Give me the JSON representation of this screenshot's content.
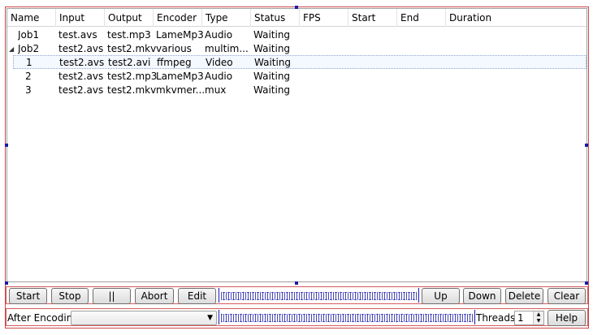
{
  "columns": [
    "Name",
    "Input",
    "Output",
    "Encoder",
    "Type",
    "Status",
    "FPS",
    "Start",
    "End",
    "Duration"
  ],
  "rows": [
    {
      "name": "Job1",
      "input": "test.avs",
      "output": "test.mp3",
      "encoder": "LameMp3",
      "type": "Audio",
      "status": "Waiting"
    },
    {
      "name": "Job2",
      "input": "test2.avs",
      "output": "test2.mkv",
      "encoder": "various",
      "type": "multim...",
      "status": "Waiting",
      "expander": "expanded-triangle-icon"
    },
    {
      "name": "1",
      "input": "test2.avs",
      "output": "test2.avi",
      "encoder": "ffmpeg",
      "type": "Video",
      "status": "Waiting"
    },
    {
      "name": "2",
      "input": "test2.avs",
      "output": "test2.mp3",
      "encoder": "LameMp3",
      "type": "Audio",
      "status": "Waiting"
    },
    {
      "name": "3",
      "input": "test2.avs",
      "output": "test2.mkv",
      "encoder": "mkvmer...",
      "type": "mux",
      "status": "Waiting"
    }
  ],
  "toolbar": {
    "start": "Start",
    "stop": "Stop",
    "pause": "||",
    "abort": "Abort",
    "edit": "Edit",
    "up": "Up",
    "down": "Down",
    "delete": "Delete",
    "clear": "Clear"
  },
  "bottom": {
    "after_encoding_label": "After Encoding:",
    "after_encoding_value": "",
    "threads_label": "Threads:",
    "threads_value": "1",
    "help": "Help"
  },
  "colors": {
    "frame": "#c94a4a",
    "handles": "#1a1aa6"
  }
}
